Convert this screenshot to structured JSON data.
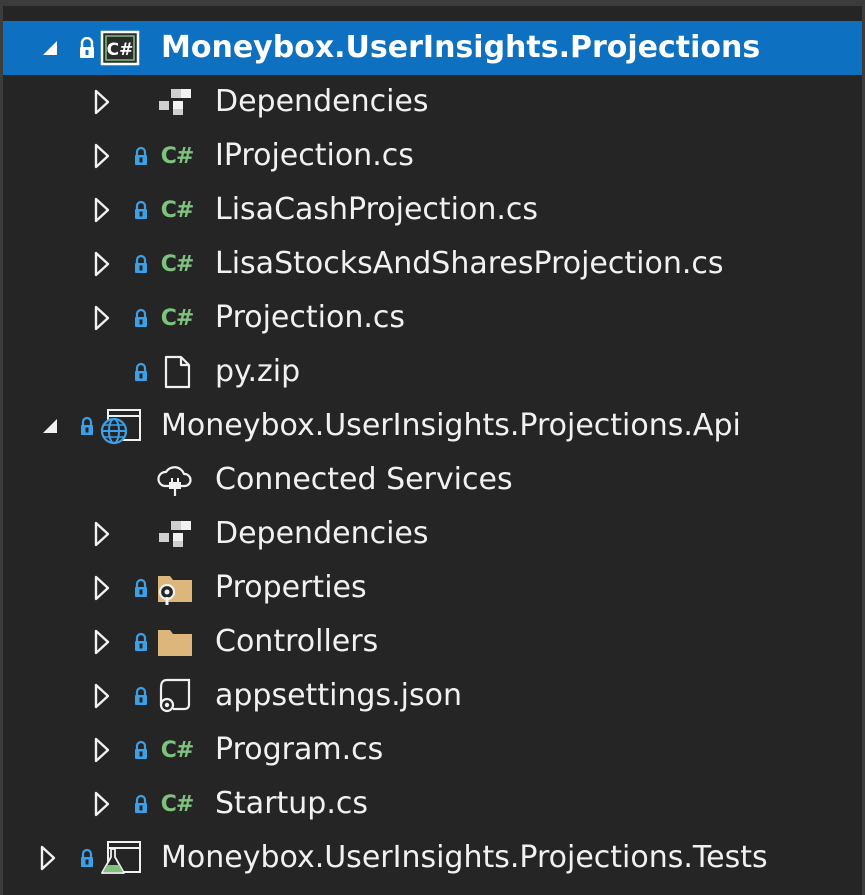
{
  "solution_explorer": {
    "projects": [
      {
        "name": "Moneybox.UserInsights.Projections",
        "icon": "csharp-project-icon",
        "expanded": true,
        "selected": true,
        "items": [
          {
            "label": "Dependencies",
            "icon": "dependencies-icon"
          },
          {
            "label": "IProjection.cs",
            "icon": "csharp-file-icon"
          },
          {
            "label": "LisaCashProjection.cs",
            "icon": "csharp-file-icon"
          },
          {
            "label": "LisaStocksAndSharesProjection.cs",
            "icon": "csharp-file-icon"
          },
          {
            "label": "Projection.cs",
            "icon": "csharp-file-icon"
          },
          {
            "label": "py.zip",
            "icon": "file-icon"
          }
        ]
      },
      {
        "name": "Moneybox.UserInsights.Projections.Api",
        "icon": "web-project-icon",
        "expanded": true,
        "items": [
          {
            "label": "Connected Services",
            "icon": "connected-services-icon"
          },
          {
            "label": "Dependencies",
            "icon": "dependencies-icon"
          },
          {
            "label": "Properties",
            "icon": "properties-folder-icon"
          },
          {
            "label": "Controllers",
            "icon": "folder-icon"
          },
          {
            "label": "appsettings.json",
            "icon": "json-file-icon"
          },
          {
            "label": "Program.cs",
            "icon": "csharp-file-icon"
          },
          {
            "label": "Startup.cs",
            "icon": "csharp-file-icon"
          }
        ]
      },
      {
        "name": "Moneybox.UserInsights.Projections.Tests",
        "icon": "test-project-icon",
        "expanded": false
      }
    ],
    "csharp_glyph": "C#",
    "colors": {
      "background": "#252526",
      "selection": "#0e70c0",
      "text": "#f1f1f1",
      "csharp_green": "#7ec27e",
      "lock_blue": "#3ca0e6",
      "folder": "#dcb67a"
    }
  }
}
